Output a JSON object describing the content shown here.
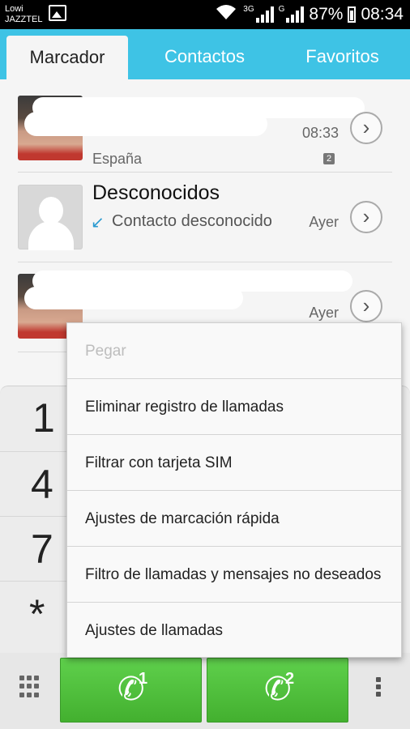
{
  "status_bar": {
    "carrier_line1": "Lowi",
    "carrier_line2": "JAZZTEL",
    "network_1": "3G",
    "network_2": "G",
    "battery": "87%",
    "time": "08:34"
  },
  "tabs": [
    {
      "label": "Marcador",
      "active": true
    },
    {
      "label": "Contactos",
      "active": false
    },
    {
      "label": "Favoritos",
      "active": false
    }
  ],
  "call_log": [
    {
      "name": "",
      "sub": "España",
      "time": "08:33",
      "sim": "2"
    },
    {
      "name": "Desconocidos",
      "sub": "Contacto desconocido",
      "time": "Ayer"
    },
    {
      "name": "",
      "sub": "",
      "time": "Ayer"
    }
  ],
  "dialpad": {
    "keys": [
      "1",
      "4",
      "7",
      "*"
    ]
  },
  "call_buttons": [
    {
      "sim": "1"
    },
    {
      "sim": "2"
    }
  ],
  "menu": {
    "items": [
      {
        "label": "Pegar",
        "enabled": false
      },
      {
        "label": "Eliminar registro de llamadas",
        "enabled": true
      },
      {
        "label": "Filtrar con tarjeta SIM",
        "enabled": true
      },
      {
        "label": "Ajustes de marcación rápida",
        "enabled": true
      },
      {
        "label": "Filtro de llamadas y mensajes no deseados",
        "enabled": true
      },
      {
        "label": "Ajustes de llamadas",
        "enabled": true
      }
    ]
  },
  "colors": {
    "tab_bar": "#3ec3e5",
    "call_green": "#4cbd38",
    "missed_call": "#2a9ad0"
  }
}
